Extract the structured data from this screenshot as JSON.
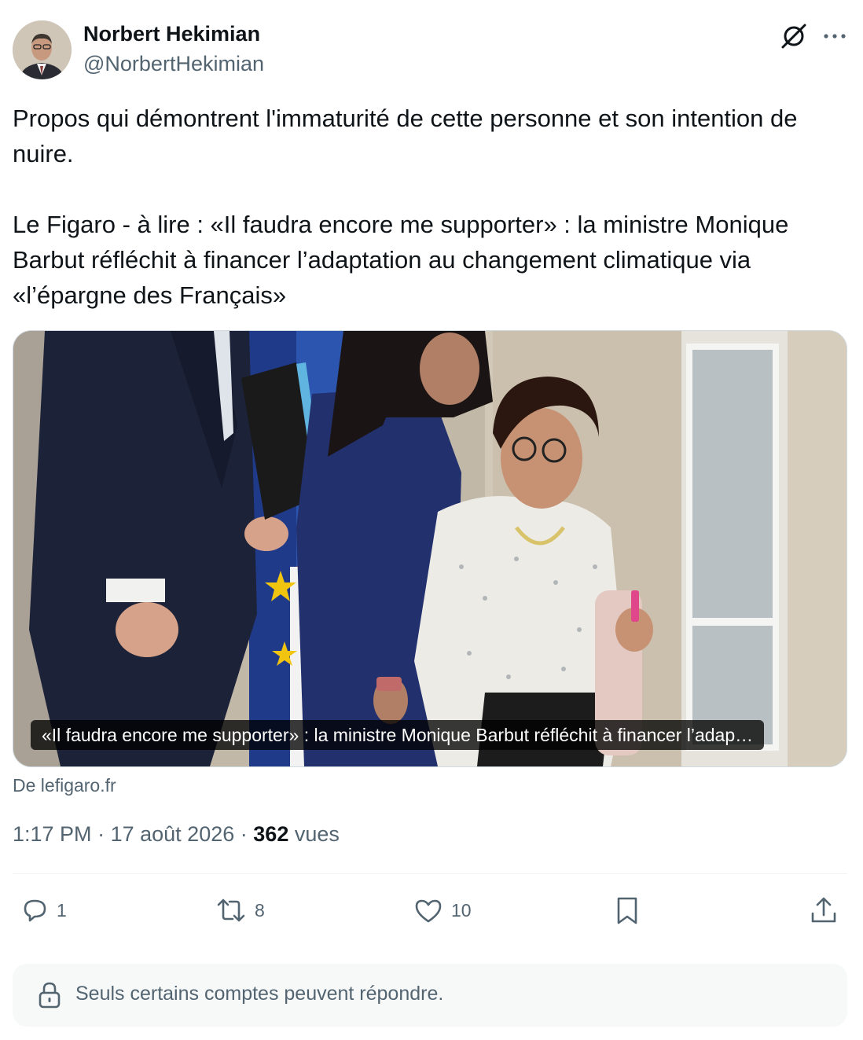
{
  "author": {
    "name": "Norbert Hekimian",
    "handle": "@NorbertHekimian"
  },
  "tweet": {
    "text": "Propos qui démontrent l'immaturité de cette personne et son intention de nuire.\n\nLe Figaro - à lire : «Il faudra encore me supporter» : la ministre Monique Barbut réfléchit à financer l’adaptation au changement climatique via «l’épargne des Français»"
  },
  "card": {
    "caption": "«Il faudra encore me supporter» : la ministre Monique Barbut réfléchit à financer l’adap…",
    "source": "De lefigaro.fr"
  },
  "meta": {
    "time": "1:17 PM",
    "separator": "·",
    "date": "17 août 2026",
    "views_count": "362",
    "views_label": "vues"
  },
  "actions": {
    "replies": "1",
    "reposts": "8",
    "likes": "10"
  },
  "reply_restriction": "Seuls certains comptes peuvent répondre.",
  "icons": [
    "grok-icon",
    "more-icon",
    "reply-icon",
    "repost-icon",
    "like-icon",
    "bookmark-icon",
    "share-icon",
    "lock-icon"
  ],
  "colors": {
    "text": "#0f1419",
    "secondary": "#536471",
    "border": "#cfd9de",
    "notice_bg": "#f7f9f9"
  }
}
